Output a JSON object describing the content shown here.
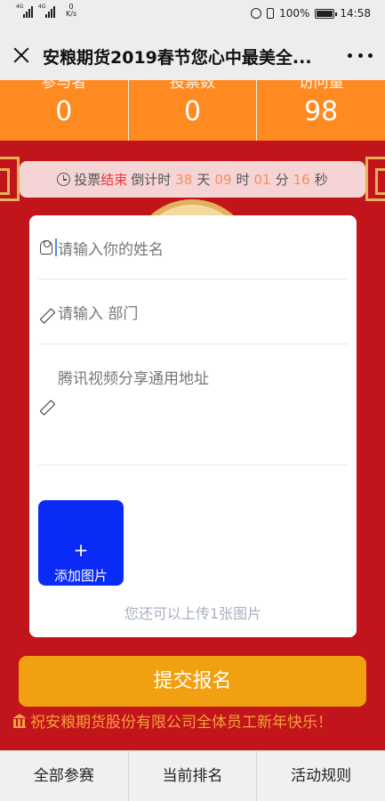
{
  "status_bar": {
    "network_1": "4G",
    "network_2": "4G",
    "speed_value": "0",
    "speed_unit": "K/s",
    "battery_percent": "100%",
    "battery_level": 1.0,
    "time": "14:58"
  },
  "title_bar": {
    "title": "安粮期货2019春节您心中最美全..."
  },
  "stats": [
    {
      "label": "参与者",
      "value": "0"
    },
    {
      "label": "投票数",
      "value": "0"
    },
    {
      "label": "访问量",
      "value": "98"
    }
  ],
  "countdown": {
    "prefix": "投票",
    "status": "结束",
    "middle": "倒计时",
    "days": "38",
    "days_unit": "天",
    "hours": "09",
    "hours_unit": "时",
    "minutes": "01",
    "minutes_unit": "分",
    "seconds": "16",
    "seconds_unit": "秒"
  },
  "form": {
    "name_placeholder": "请输入你的姓名",
    "department_placeholder": "请输入 部门",
    "video_placeholder": "腾讯视频分享通用地址",
    "upload_plus": "+",
    "upload_label": "添加图片",
    "upload_hint": "您还可以上传1张图片"
  },
  "submit_label": "提交报名",
  "greeting": "祝安粮期货股份有限公司全体员工新年快乐！",
  "bottom_nav": [
    {
      "label": "全部参赛"
    },
    {
      "label": "当前排名"
    },
    {
      "label": "活动规则"
    }
  ],
  "colors": {
    "background_red": "#c2141b",
    "stats_orange": "#ff8a22",
    "submit_orange": "#f0a010",
    "upload_blue": "#0a2bf5",
    "greeting_gold": "#f4a23a"
  }
}
